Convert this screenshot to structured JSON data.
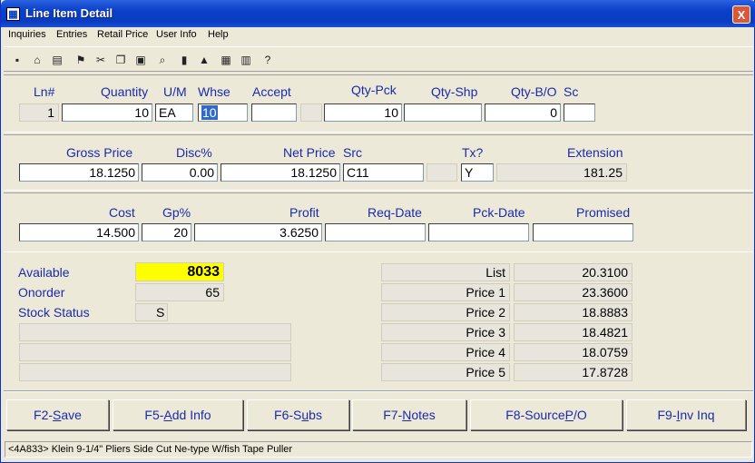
{
  "window": {
    "title": "Line Item Detail",
    "close_glyph": "X"
  },
  "menu": [
    "Inquiries",
    "Entries",
    "Retail Price",
    "User Info",
    "Help"
  ],
  "toolbar": [
    "save-icon",
    "basket-icon",
    "print-icon",
    "runner-icon",
    "cut-icon",
    "copy-icon",
    "paste-icon",
    "find-icon",
    "door-icon",
    "chart-icon",
    "calculator-icon",
    "calendar-icon",
    "help-icon"
  ],
  "line": {
    "labels": {
      "ln": "Ln#",
      "quantity": "Quantity",
      "um": "U/M",
      "whse": "Whse",
      "accept": "Accept",
      "qty_pck": "Qty-Pck",
      "qty_shp": "Qty-Shp",
      "qty_bo": "Qty-B/O",
      "sc": "Sc"
    },
    "values": {
      "ln": "1",
      "quantity": "10",
      "um": "EA",
      "whse": "10",
      "accept": "",
      "qty_pck": "10",
      "qty_shp": "",
      "qty_bo": "0",
      "sc": ""
    }
  },
  "price": {
    "labels": {
      "gross": "Gross Price",
      "disc": "Disc%",
      "net": "Net Price",
      "src": "Src",
      "tx": "Tx?",
      "ext": "Extension"
    },
    "values": {
      "gross": "18.1250",
      "disc": "0.00",
      "net": "18.1250",
      "src": "C11",
      "tx": "Y",
      "ext": "181.25"
    }
  },
  "cost": {
    "labels": {
      "cost": "Cost",
      "gp": "Gp%",
      "profit": "Profit",
      "req": "Req-Date",
      "pck": "Pck-Date",
      "promised": "Promised"
    },
    "values": {
      "cost": "14.500",
      "gp": "20",
      "profit": "3.6250",
      "req": "",
      "pck": "",
      "promised": ""
    }
  },
  "stock": {
    "available_label": "Available",
    "available": "8033",
    "onorder_label": "Onorder",
    "onorder": "65",
    "status_label": "Stock Status",
    "status": "S"
  },
  "prices": [
    {
      "label": "List",
      "value": "20.3100"
    },
    {
      "label": "Price 1",
      "value": "23.3600"
    },
    {
      "label": "Price 2",
      "value": "18.8883"
    },
    {
      "label": "Price 3",
      "value": "18.4821"
    },
    {
      "label": "Price 4",
      "value": "18.0759"
    },
    {
      "label": "Price 5",
      "value": "17.8728"
    }
  ],
  "fkeys": [
    {
      "pre": "F2-",
      "u": "S",
      "post": "ave"
    },
    {
      "pre": "F5-",
      "u": "A",
      "post": "dd Info"
    },
    {
      "pre": "F6-S",
      "u": "u",
      "post": "bs"
    },
    {
      "pre": "F7-",
      "u": "N",
      "post": "otes"
    },
    {
      "pre": "F8-Source ",
      "u": "P",
      "post": "/O"
    },
    {
      "pre": "F9-",
      "u": "I",
      "post": "nv Inq"
    }
  ],
  "status_text": "<4A833> Klein 9-1/4\" Pliers Side Cut Ne-type W/fish Tape Puller"
}
